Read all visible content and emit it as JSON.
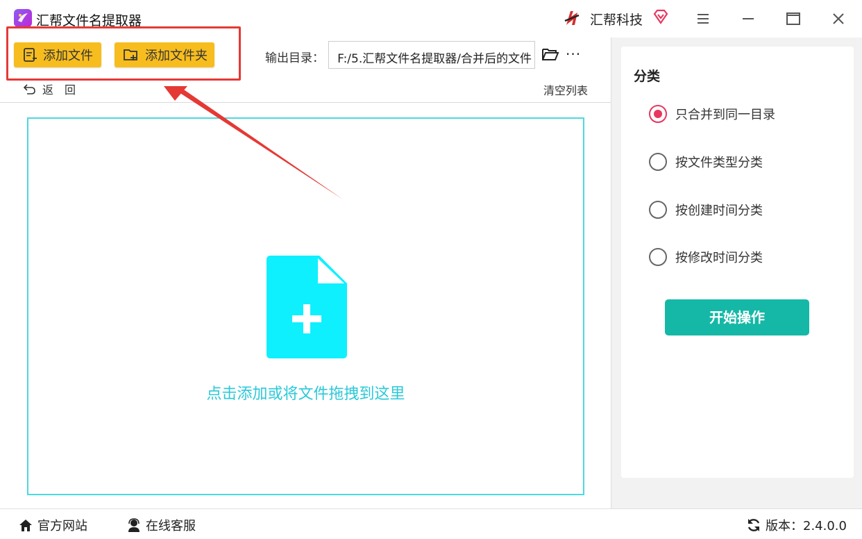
{
  "app": {
    "title": "汇帮文件名提取器",
    "brand_name": "汇帮科技"
  },
  "toolbar": {
    "add_file_label": "添加文件",
    "add_folder_label": "添加文件夹",
    "output_label": "输出目录：",
    "output_path": "F:/5.汇帮文件名提取器/合并后的文件",
    "more_label": "···",
    "back_label": "返　回",
    "clear_label": "清空列表"
  },
  "drop_zone": {
    "text": "点击添加或将文件拖拽到这里"
  },
  "sidebar": {
    "title": "分类",
    "options": [
      {
        "label": "只合并到同一目录",
        "checked": true
      },
      {
        "label": "按文件类型分类",
        "checked": false
      },
      {
        "label": "按创建时间分类",
        "checked": false
      },
      {
        "label": "按修改时间分类",
        "checked": false
      }
    ],
    "start_label": "开始操作"
  },
  "footer": {
    "site_label": "官方网站",
    "service_label": "在线客服",
    "version_label": "版本：2.4.0.0"
  },
  "colors": {
    "accent_yellow": "#f7bd1f",
    "accent_cyan": "#0ff0ff",
    "radio_selected": "#e8365d",
    "start_button": "#15b8a6",
    "annotation_red": "#e53935"
  }
}
